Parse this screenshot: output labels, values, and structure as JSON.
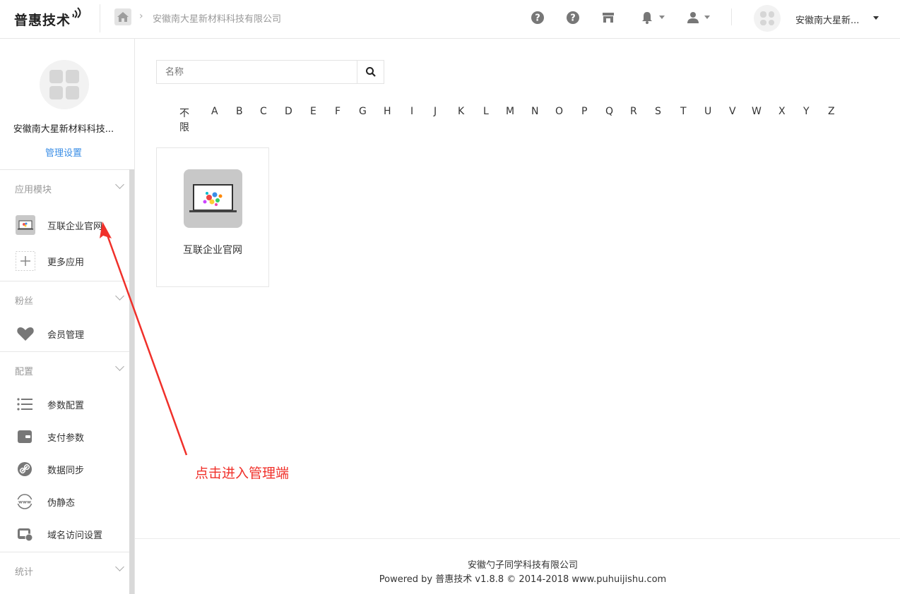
{
  "header": {
    "logo_text": "普惠技术",
    "breadcrumb": "安徽南大星新材料科技有限公司",
    "company_short": "安徽南大星新...",
    "icons": [
      "help-icon",
      "help-icon",
      "store-icon",
      "bell-icon",
      "user-icon"
    ]
  },
  "sidebar": {
    "company_name": "安徽南大星新材料科技...",
    "manage_link": "管理设置",
    "sections": [
      {
        "title": "应用模块",
        "items": [
          {
            "label": "互联企业官网",
            "icon": "website-app-icon"
          },
          {
            "label": "更多应用",
            "icon": "plus-icon"
          }
        ]
      },
      {
        "title": "粉丝",
        "items": [
          {
            "label": "会员管理",
            "icon": "heart-icon"
          }
        ]
      },
      {
        "title": "配置",
        "items": [
          {
            "label": "参数配置",
            "icon": "list-icon"
          },
          {
            "label": "支付参数",
            "icon": "wallet-icon"
          },
          {
            "label": "数据同步",
            "icon": "link-icon"
          },
          {
            "label": "伪静态",
            "icon": "www-icon"
          },
          {
            "label": "域名访问设置",
            "icon": "domain-icon"
          }
        ]
      },
      {
        "title": "统计",
        "items": []
      }
    ]
  },
  "main": {
    "search_placeholder": "名称",
    "letter_filter": [
      "不限",
      "A",
      "B",
      "C",
      "D",
      "E",
      "F",
      "G",
      "H",
      "I",
      "J",
      "K",
      "L",
      "M",
      "N",
      "O",
      "P",
      "Q",
      "R",
      "S",
      "T",
      "U",
      "V",
      "W",
      "X",
      "Y",
      "Z"
    ],
    "apps": [
      {
        "name": "互联企业官网"
      }
    ]
  },
  "annotation": {
    "text": "点击进入管理端",
    "color": "#f0302a"
  },
  "footer": {
    "company": "安徽勺子同学科技有限公司",
    "powered": "Powered by 普惠技术 v1.8.8 © 2014-2018 www.puhuijishu.com"
  },
  "colors": {
    "accent": "#3a8ee6",
    "annotation": "#f0302a"
  }
}
